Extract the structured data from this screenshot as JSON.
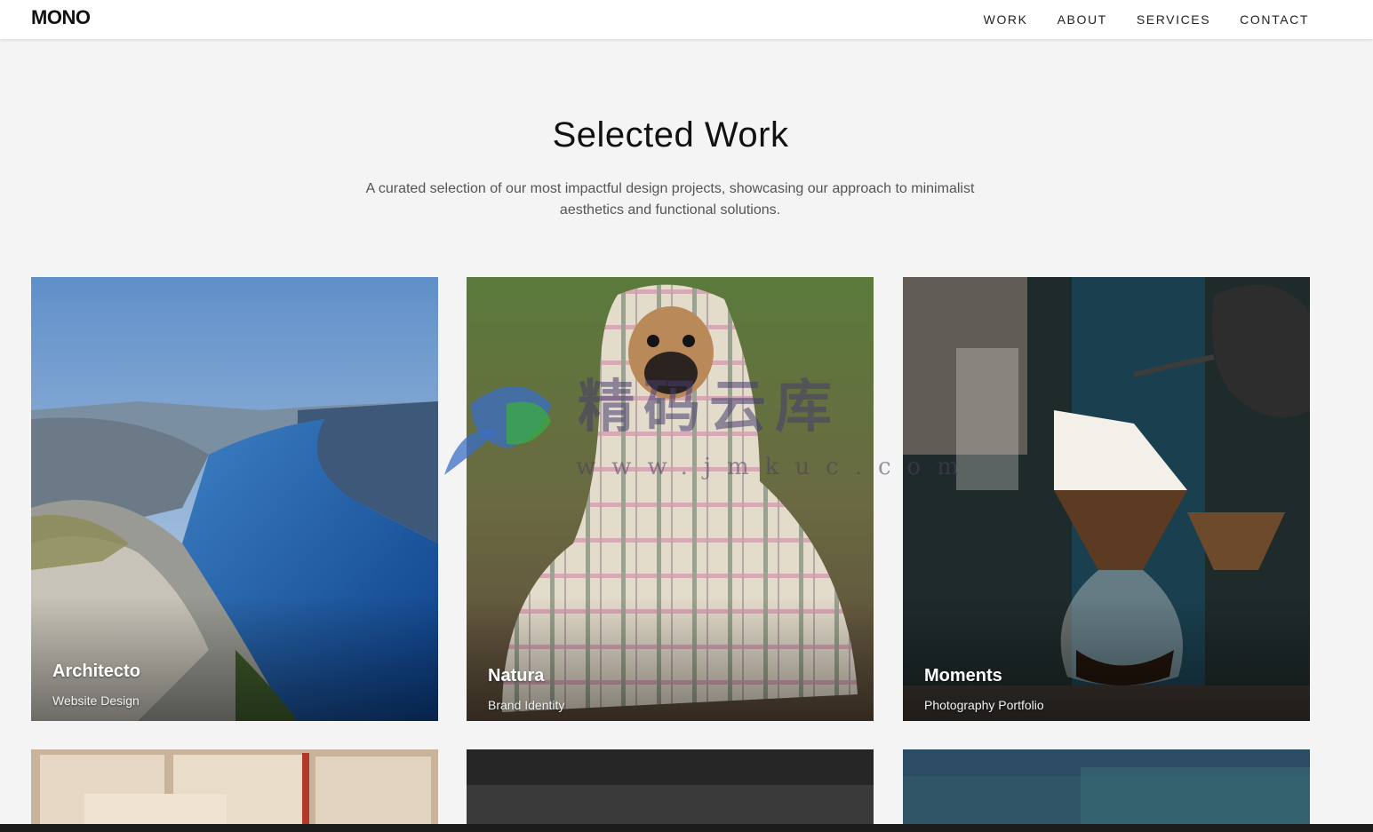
{
  "brand": {
    "logo": "MONO"
  },
  "nav": {
    "items": [
      {
        "label": "WORK"
      },
      {
        "label": "ABOUT"
      },
      {
        "label": "SERVICES"
      },
      {
        "label": "CONTACT"
      }
    ]
  },
  "hero": {
    "title": "Selected Work",
    "description": "A curated selection of our most impactful design projects, showcasing our approach to minimalist aesthetics and functional solutions."
  },
  "projects": [
    {
      "title": "Architecto",
      "category": "Website Design"
    },
    {
      "title": "Natura",
      "category": "Brand Identity"
    },
    {
      "title": "Moments",
      "category": "Photography Portfolio"
    }
  ],
  "watermark": {
    "text": "精码云库",
    "url": "www.jmkuc.com"
  }
}
